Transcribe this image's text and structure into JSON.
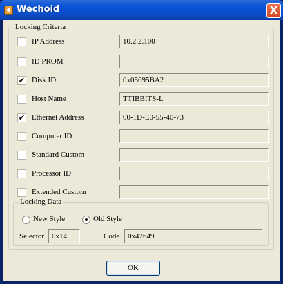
{
  "window": {
    "title": "Wechoid",
    "close_glyph": "X"
  },
  "locking_criteria": {
    "title": "Locking Criteria",
    "rows": [
      {
        "label": "IP Address",
        "checked": false,
        "value": "10.2.2.100"
      },
      {
        "label": "ID PROM",
        "checked": false,
        "value": ""
      },
      {
        "label": "Disk ID",
        "checked": true,
        "value": "0x05695BA2"
      },
      {
        "label": "Host Name",
        "checked": false,
        "value": "TTIBBITS-L"
      },
      {
        "label": "Ethernet Address",
        "checked": true,
        "value": "00-1D-E0-55-40-73"
      },
      {
        "label": "Computer ID",
        "checked": false,
        "value": ""
      },
      {
        "label": "Standard Custom",
        "checked": false,
        "value": ""
      },
      {
        "label": "Processor ID",
        "checked": false,
        "value": ""
      },
      {
        "label": "Extended Custom",
        "checked": false,
        "value": ""
      }
    ]
  },
  "locking_data": {
    "title": "Locking Data",
    "new_style_label": "New Style",
    "old_style_label": "Old Style",
    "selected_style": "Old Style",
    "selector_label": "Selector",
    "selector_value": "0x14",
    "code_label": "Code",
    "code_value": "0x47649"
  },
  "ok_label": "OK"
}
